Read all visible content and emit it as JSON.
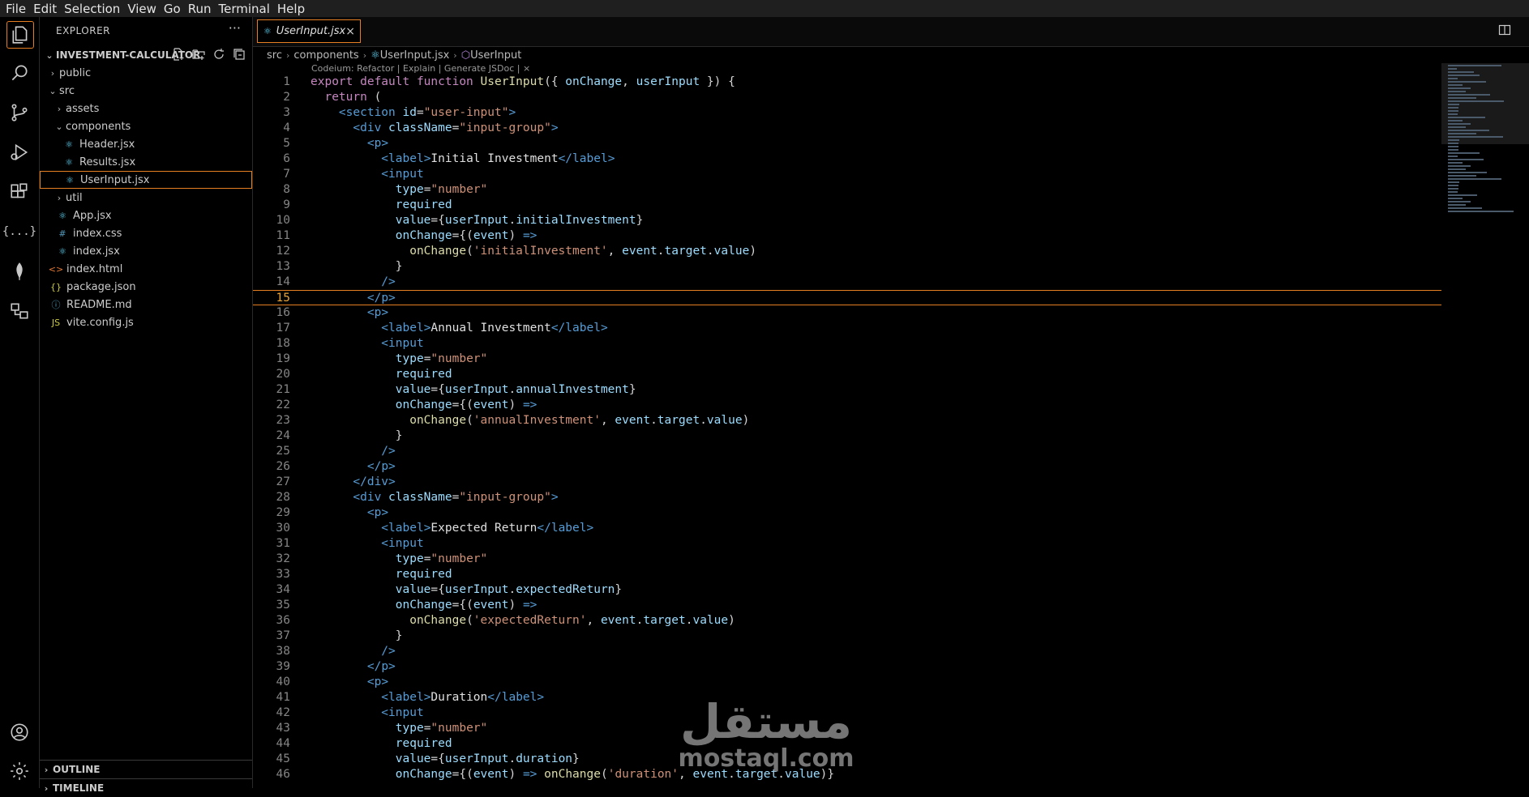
{
  "menu": [
    "File",
    "Edit",
    "Selection",
    "View",
    "Go",
    "Run",
    "Terminal",
    "Help"
  ],
  "explorer": {
    "title": "EXPLORER",
    "more": "···",
    "project": "INVESTMENT-CALCULATOR",
    "tree": [
      {
        "label": "public",
        "type": "folder",
        "open": false,
        "depth": 1
      },
      {
        "label": "src",
        "type": "folder",
        "open": true,
        "depth": 1
      },
      {
        "label": "assets",
        "type": "folder",
        "open": false,
        "depth": 2
      },
      {
        "label": "components",
        "type": "folder",
        "open": true,
        "depth": 2
      },
      {
        "label": "Header.jsx",
        "type": "jsx",
        "depth": 3
      },
      {
        "label": "Results.jsx",
        "type": "jsx",
        "depth": 3
      },
      {
        "label": "UserInput.jsx",
        "type": "jsx",
        "depth": 3,
        "selected": true
      },
      {
        "label": "util",
        "type": "folder",
        "open": false,
        "depth": 2
      },
      {
        "label": "App.jsx",
        "type": "jsx",
        "depth": 2
      },
      {
        "label": "index.css",
        "type": "css",
        "depth": 2
      },
      {
        "label": "index.jsx",
        "type": "jsx",
        "depth": 2
      },
      {
        "label": "index.html",
        "type": "html",
        "depth": 1
      },
      {
        "label": "package.json",
        "type": "json",
        "depth": 1
      },
      {
        "label": "README.md",
        "type": "md",
        "depth": 1
      },
      {
        "label": "vite.config.js",
        "type": "js",
        "depth": 1
      }
    ],
    "outline": "OUTLINE",
    "timeline": "TIMELINE"
  },
  "tab": {
    "label": "UserInput.jsx",
    "close": "×"
  },
  "breadcrumb": [
    "src",
    "components",
    "UserInput.jsx",
    "UserInput"
  ],
  "codelens": "Codeium: Refactor | Explain | Generate JSDoc | ×",
  "current_line": 15,
  "code_lines": [
    [
      [
        "export default function ",
        "kw"
      ],
      [
        "UserInput",
        "fn"
      ],
      [
        "({ ",
        "p"
      ],
      [
        "onChange",
        "v"
      ],
      [
        ", ",
        "p"
      ],
      [
        "userInput",
        "v"
      ],
      [
        " }) {",
        "p"
      ]
    ],
    [
      [
        "  return ",
        "kw"
      ],
      [
        "(",
        "p"
      ]
    ],
    [
      [
        "    <",
        "t"
      ],
      [
        "section ",
        "t"
      ],
      [
        "id",
        "a"
      ],
      [
        "=",
        "p"
      ],
      [
        "\"user-input\"",
        "s"
      ],
      [
        ">",
        "t"
      ]
    ],
    [
      [
        "      <",
        "t"
      ],
      [
        "div ",
        "t"
      ],
      [
        "className",
        "a"
      ],
      [
        "=",
        "p"
      ],
      [
        "\"input-group\"",
        "s"
      ],
      [
        ">",
        "t"
      ]
    ],
    [
      [
        "        <",
        "t"
      ],
      [
        "p",
        "t"
      ],
      [
        ">",
        "t"
      ]
    ],
    [
      [
        "          <",
        "t"
      ],
      [
        "label",
        "t"
      ],
      [
        ">",
        "t"
      ],
      [
        "Initial Investment",
        "x"
      ],
      [
        "</",
        "t"
      ],
      [
        "label",
        "t"
      ],
      [
        ">",
        "t"
      ]
    ],
    [
      [
        "          <",
        "t"
      ],
      [
        "input",
        "t"
      ]
    ],
    [
      [
        "            type",
        "a"
      ],
      [
        "=",
        "p"
      ],
      [
        "\"number\"",
        "s"
      ]
    ],
    [
      [
        "            required",
        "a"
      ]
    ],
    [
      [
        "            value",
        "a"
      ],
      [
        "={",
        "p"
      ],
      [
        "userInput",
        "v"
      ],
      [
        ".",
        "p"
      ],
      [
        "initialInvestment",
        "v"
      ],
      [
        "}",
        "p"
      ]
    ],
    [
      [
        "            onChange",
        "a"
      ],
      [
        "={(",
        "p"
      ],
      [
        "event",
        "v"
      ],
      [
        ") ",
        "p"
      ],
      [
        "=>",
        "t"
      ]
    ],
    [
      [
        "              onChange",
        "fn"
      ],
      [
        "(",
        "p"
      ],
      [
        "'initialInvestment'",
        "s"
      ],
      [
        ", ",
        "p"
      ],
      [
        "event",
        "v"
      ],
      [
        ".",
        "p"
      ],
      [
        "target",
        "v"
      ],
      [
        ".",
        "p"
      ],
      [
        "value",
        "v"
      ],
      [
        ")",
        "p"
      ]
    ],
    [
      [
        "            }",
        "p"
      ]
    ],
    [
      [
        "          />",
        "t"
      ]
    ],
    [
      [
        "        </",
        "t"
      ],
      [
        "p",
        "t"
      ],
      [
        ">",
        "t"
      ]
    ],
    [
      [
        "        <",
        "t"
      ],
      [
        "p",
        "t"
      ],
      [
        ">",
        "t"
      ]
    ],
    [
      [
        "          <",
        "t"
      ],
      [
        "label",
        "t"
      ],
      [
        ">",
        "t"
      ],
      [
        "Annual Investment",
        "x"
      ],
      [
        "</",
        "t"
      ],
      [
        "label",
        "t"
      ],
      [
        ">",
        "t"
      ]
    ],
    [
      [
        "          <",
        "t"
      ],
      [
        "input",
        "t"
      ]
    ],
    [
      [
        "            type",
        "a"
      ],
      [
        "=",
        "p"
      ],
      [
        "\"number\"",
        "s"
      ]
    ],
    [
      [
        "            required",
        "a"
      ]
    ],
    [
      [
        "            value",
        "a"
      ],
      [
        "={",
        "p"
      ],
      [
        "userInput",
        "v"
      ],
      [
        ".",
        "p"
      ],
      [
        "annualInvestment",
        "v"
      ],
      [
        "}",
        "p"
      ]
    ],
    [
      [
        "            onChange",
        "a"
      ],
      [
        "={(",
        "p"
      ],
      [
        "event",
        "v"
      ],
      [
        ") ",
        "p"
      ],
      [
        "=>",
        "t"
      ]
    ],
    [
      [
        "              onChange",
        "fn"
      ],
      [
        "(",
        "p"
      ],
      [
        "'annualInvestment'",
        "s"
      ],
      [
        ", ",
        "p"
      ],
      [
        "event",
        "v"
      ],
      [
        ".",
        "p"
      ],
      [
        "target",
        "v"
      ],
      [
        ".",
        "p"
      ],
      [
        "value",
        "v"
      ],
      [
        ")",
        "p"
      ]
    ],
    [
      [
        "            }",
        "p"
      ]
    ],
    [
      [
        "          />",
        "t"
      ]
    ],
    [
      [
        "        </",
        "t"
      ],
      [
        "p",
        "t"
      ],
      [
        ">",
        "t"
      ]
    ],
    [
      [
        "      </",
        "t"
      ],
      [
        "div",
        "t"
      ],
      [
        ">",
        "t"
      ]
    ],
    [
      [
        "      <",
        "t"
      ],
      [
        "div ",
        "t"
      ],
      [
        "className",
        "a"
      ],
      [
        "=",
        "p"
      ],
      [
        "\"input-group\"",
        "s"
      ],
      [
        ">",
        "t"
      ]
    ],
    [
      [
        "        <",
        "t"
      ],
      [
        "p",
        "t"
      ],
      [
        ">",
        "t"
      ]
    ],
    [
      [
        "          <",
        "t"
      ],
      [
        "label",
        "t"
      ],
      [
        ">",
        "t"
      ],
      [
        "Expected Return",
        "x"
      ],
      [
        "</",
        "t"
      ],
      [
        "label",
        "t"
      ],
      [
        ">",
        "t"
      ]
    ],
    [
      [
        "          <",
        "t"
      ],
      [
        "input",
        "t"
      ]
    ],
    [
      [
        "            type",
        "a"
      ],
      [
        "=",
        "p"
      ],
      [
        "\"number\"",
        "s"
      ]
    ],
    [
      [
        "            required",
        "a"
      ]
    ],
    [
      [
        "            value",
        "a"
      ],
      [
        "={",
        "p"
      ],
      [
        "userInput",
        "v"
      ],
      [
        ".",
        "p"
      ],
      [
        "expectedReturn",
        "v"
      ],
      [
        "}",
        "p"
      ]
    ],
    [
      [
        "            onChange",
        "a"
      ],
      [
        "={(",
        "p"
      ],
      [
        "event",
        "v"
      ],
      [
        ") ",
        "p"
      ],
      [
        "=>",
        "t"
      ]
    ],
    [
      [
        "              onChange",
        "fn"
      ],
      [
        "(",
        "p"
      ],
      [
        "'expectedReturn'",
        "s"
      ],
      [
        ", ",
        "p"
      ],
      [
        "event",
        "v"
      ],
      [
        ".",
        "p"
      ],
      [
        "target",
        "v"
      ],
      [
        ".",
        "p"
      ],
      [
        "value",
        "v"
      ],
      [
        ")",
        "p"
      ]
    ],
    [
      [
        "            }",
        "p"
      ]
    ],
    [
      [
        "          />",
        "t"
      ]
    ],
    [
      [
        "        </",
        "t"
      ],
      [
        "p",
        "t"
      ],
      [
        ">",
        "t"
      ]
    ],
    [
      [
        "        <",
        "t"
      ],
      [
        "p",
        "t"
      ],
      [
        ">",
        "t"
      ]
    ],
    [
      [
        "          <",
        "t"
      ],
      [
        "label",
        "t"
      ],
      [
        ">",
        "t"
      ],
      [
        "Duration",
        "x"
      ],
      [
        "</",
        "t"
      ],
      [
        "label",
        "t"
      ],
      [
        ">",
        "t"
      ]
    ],
    [
      [
        "          <",
        "t"
      ],
      [
        "input",
        "t"
      ]
    ],
    [
      [
        "            type",
        "a"
      ],
      [
        "=",
        "p"
      ],
      [
        "\"number\"",
        "s"
      ]
    ],
    [
      [
        "            required",
        "a"
      ]
    ],
    [
      [
        "            value",
        "a"
      ],
      [
        "={",
        "p"
      ],
      [
        "userInput",
        "v"
      ],
      [
        ".",
        "p"
      ],
      [
        "duration",
        "v"
      ],
      [
        "}",
        "p"
      ]
    ],
    [
      [
        "            onChange",
        "a"
      ],
      [
        "={(",
        "p"
      ],
      [
        "event",
        "v"
      ],
      [
        ") ",
        "p"
      ],
      [
        "=>",
        "t"
      ],
      [
        " onChange",
        "fn"
      ],
      [
        "(",
        "p"
      ],
      [
        "'duration'",
        "s"
      ],
      [
        ", ",
        "p"
      ],
      [
        "event",
        "v"
      ],
      [
        ".",
        "p"
      ],
      [
        "target",
        "v"
      ],
      [
        ".",
        "p"
      ],
      [
        "value",
        "v"
      ],
      [
        ")}",
        "p"
      ]
    ]
  ],
  "colors": {
    "kw": "#c586c0",
    "fn": "#dcdcaa",
    "p": "#d4d4d4",
    "v": "#9cdcfe",
    "t": "#569cd6",
    "a": "#9cdcfe",
    "s": "#ce9178",
    "x": "#e0e0e0",
    "accent": "#e67e22"
  },
  "watermark": {
    "arabic": "مستقل",
    "latin": "mostaql.com"
  }
}
